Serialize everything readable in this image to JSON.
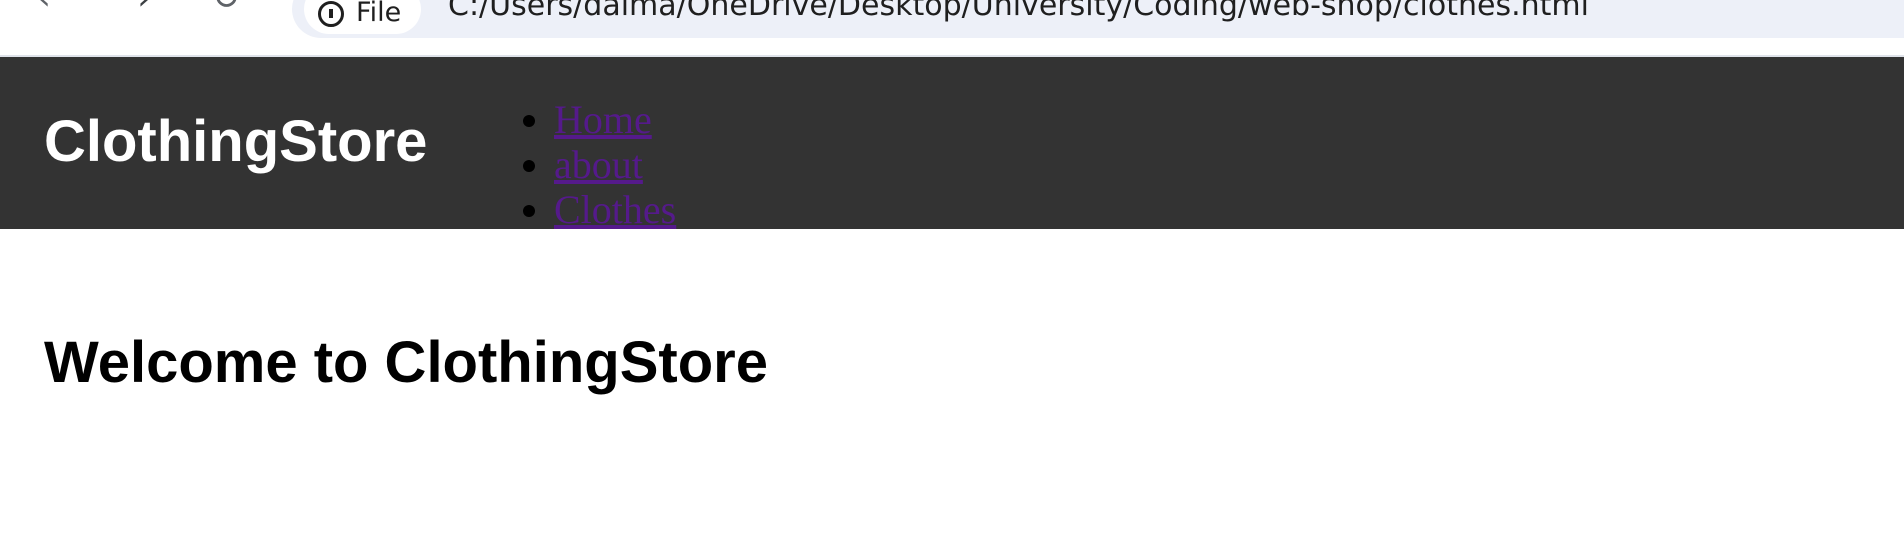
{
  "browser": {
    "back_icon": "back-arrow-icon",
    "forward_icon": "forward-arrow-icon",
    "reload_icon": "reload-icon",
    "info_icon": "info-icon",
    "scheme_label": "File",
    "url": "C:/Users/dalma/OneDrive/Desktop/University/Coding/web-shop/clothes.html"
  },
  "header": {
    "logo": "ClothingStore",
    "background_color": "#333333",
    "nav_items": [
      {
        "label": "Home"
      },
      {
        "label": "about"
      },
      {
        "label": "Clothes"
      }
    ],
    "link_color": "#551a8b"
  },
  "main": {
    "welcome_heading": "Welcome to ClothingStore"
  }
}
